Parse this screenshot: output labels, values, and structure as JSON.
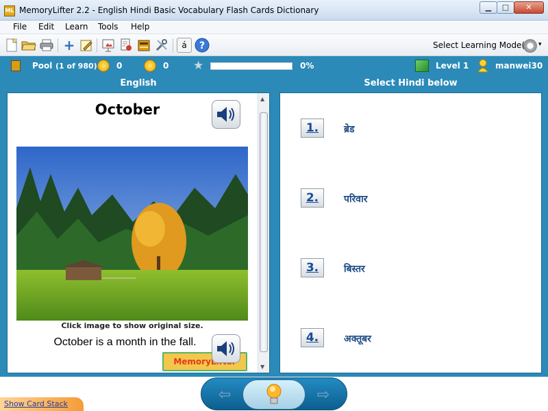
{
  "window": {
    "app_icon": "ML",
    "title": "MemoryLifter 2.2 - English Hindi Basic Vocabulary Flash Cards Dictionary",
    "min_glyph": "▁",
    "max_glyph": "□",
    "close_glyph": "✕"
  },
  "menu": [
    "File",
    "Edit",
    "Learn",
    "Tools",
    "Help"
  ],
  "toolbar": {
    "mode_label": "Select Learning Mode(s)",
    "mode_caret": "▾",
    "accent_button": "á"
  },
  "status": {
    "pool_label": "Pool",
    "pool_count": "(1 of 980)",
    "correct_count": "0",
    "wrong_count": "0",
    "progress_percent": 0,
    "progress_label": "0%",
    "level_label": "Level 1",
    "username": "manwei30"
  },
  "question": {
    "header": "English",
    "word": "October",
    "image_caption": "Click image to show original size.",
    "sentence": "October is a month in the fall.",
    "logo_text": "MemoryLifter"
  },
  "answers": {
    "header": "Select Hindi below",
    "choices": [
      {
        "number": "1.",
        "text": "ब्रेड"
      },
      {
        "number": "2.",
        "text": "परिवार"
      },
      {
        "number": "3.",
        "text": "बिस्तर"
      },
      {
        "number": "4.",
        "text": "अक्तूबर"
      }
    ]
  },
  "nav": {
    "prev_glyph": "⇦",
    "next_glyph": "⇨",
    "show_card_stack": "Show Card Stack"
  },
  "colors": {
    "frame_blue": "#2b8ab8",
    "progress_green": "#7ac04b",
    "answer_blue": "#1d4c86"
  }
}
